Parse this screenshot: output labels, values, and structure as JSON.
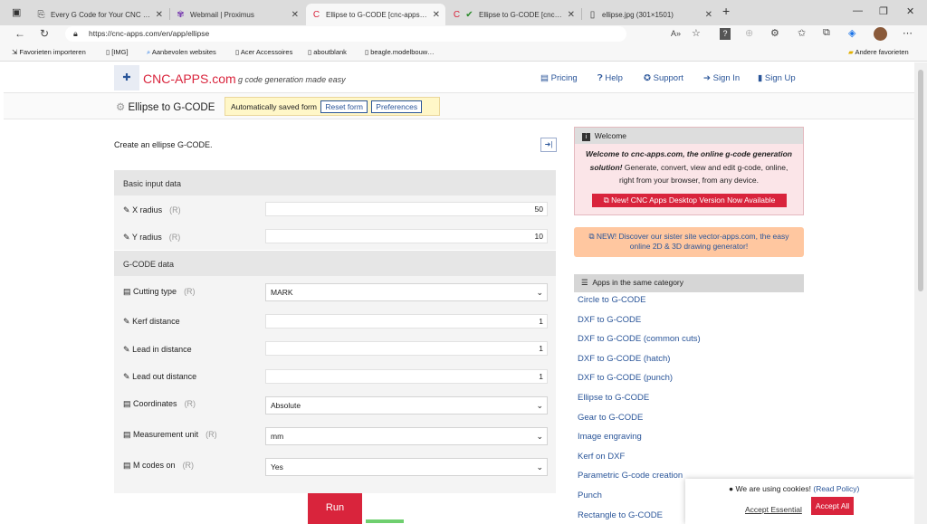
{
  "browser": {
    "tabs": [
      {
        "title": "Every G Code for Your CNC (The",
        "icon": "page-icon"
      },
      {
        "title": "Webmail | Proximus",
        "icon": "proximus-icon"
      },
      {
        "title": "Ellipse to G-CODE [cnc-apps.com",
        "icon": "cnc-apps-icon"
      },
      {
        "title": "Ellipse to G-CODE [cnc-apps.co",
        "icon": "cnc-apps-icon"
      },
      {
        "title": "ellipse.jpg (301×1501)",
        "icon": "image-icon"
      }
    ],
    "url": "https://cnc-apps.com/en/app/ellipse",
    "favorites": [
      "Favorieten importeren",
      "[IMG]",
      "Aanbevolen websites",
      "Acer Accessoires",
      "aboutblank",
      "beagle.modelbouw…",
      "Andere favorieten"
    ]
  },
  "site": {
    "logo": "CNC-APPS.com",
    "tagline": "g code generation made easy",
    "nav": [
      "Pricing",
      "Help",
      "Support",
      "Sign In",
      "Sign Up"
    ]
  },
  "app": {
    "title": "Ellipse to G-CODE",
    "autosave": "Automatically saved form",
    "reset": "Reset form",
    "prefs": "Preferences",
    "intro": "Create an ellipse G-CODE.",
    "required_mark": "(R)",
    "sections": [
      "Basic input data",
      "G-CODE data"
    ],
    "fields": {
      "x_radius": {
        "label": "X radius",
        "value": "50"
      },
      "y_radius": {
        "label": "Y radius",
        "value": "10"
      },
      "cutting_type": {
        "label": "Cutting type",
        "value": "MARK"
      },
      "kerf": {
        "label": "Kerf distance",
        "value": "1"
      },
      "lead_in": {
        "label": "Lead in distance",
        "value": "1"
      },
      "lead_out": {
        "label": "Lead out distance",
        "value": "1"
      },
      "coordinates": {
        "label": "Coordinates",
        "value": "Absolute"
      },
      "unit": {
        "label": "Measurement unit",
        "value": "mm"
      },
      "mcodes": {
        "label": "M codes on",
        "value": "Yes"
      }
    },
    "run": "Run"
  },
  "sidebar": {
    "welcome_title": "Welcome",
    "welcome_em": "Welcome to cnc-apps.com, the online g-code generation solution!",
    "welcome_text": "Generate, convert, view and edit g-code, online, right from your browser, from any device.",
    "desktop_btn": "New! CNC Apps Desktop Version Now Available",
    "vector_link": "NEW! Discover our sister site vector-apps.com, the easy online 2D & 3D drawing generator!",
    "category_title": "Apps in the same category",
    "category_links": [
      "Circle to G-CODE",
      "DXF to G-CODE",
      "DXF to G-CODE (common cuts)",
      "DXF to G-CODE (hatch)",
      "DXF to G-CODE (punch)",
      "Ellipse to G-CODE",
      "Gear to G-CODE",
      "Image engraving",
      "Kerf on DXF",
      "Parametric G-code creation",
      "Punch",
      "Rectangle to G-CODE"
    ]
  },
  "cookie": {
    "text": "We are using cookies!",
    "policy": "(Read Policy)",
    "essential": "Accept Essential",
    "all": "Accept All"
  },
  "colors": {
    "brand": "#d9243c",
    "link": "#2a5599"
  }
}
